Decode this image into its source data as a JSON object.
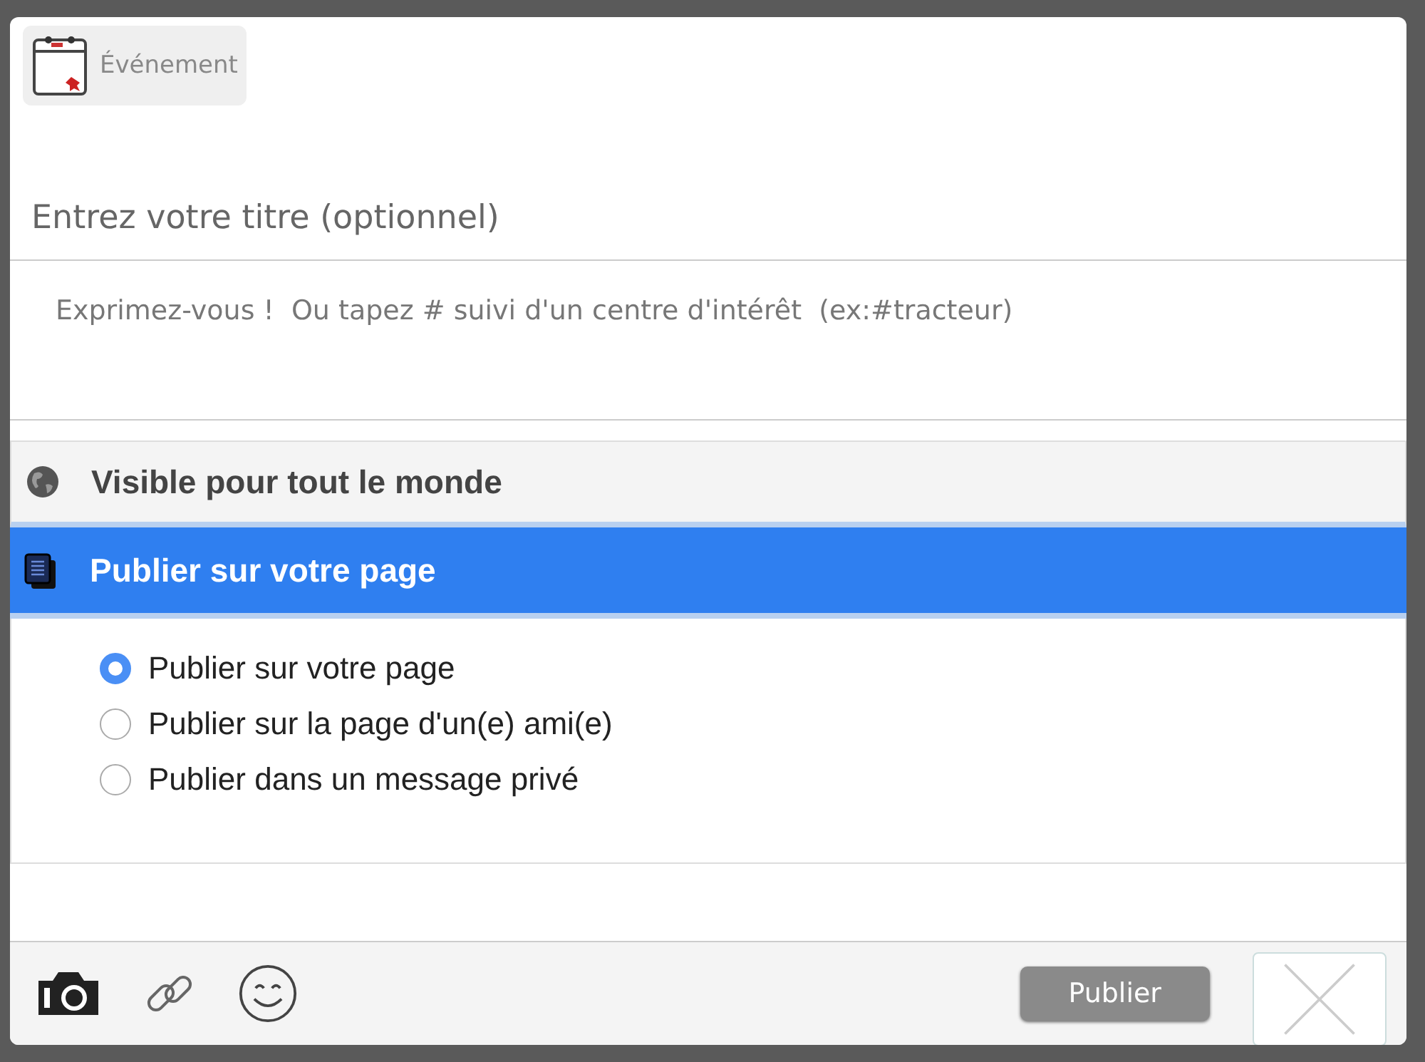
{
  "post_type": {
    "label": "Événement",
    "selected": true
  },
  "title_field": {
    "placeholder": "Entrez votre titre (optionnel)"
  },
  "message_field": {
    "placeholder": "Exprimez-vous !  Ou tapez # suivi d'un centre d'intérêt  (ex:#tracteur)"
  },
  "visibility": {
    "label": "Visible pour tout le monde"
  },
  "destination": {
    "label": "Publier sur votre page",
    "expanded": true
  },
  "options": [
    {
      "label": "Publier sur votre page",
      "selected": true
    },
    {
      "label": "Publier sur la page d'un(e) ami(e)",
      "selected": false
    },
    {
      "label": "Publier dans un message privé",
      "selected": false
    }
  ],
  "footer": {
    "publish_button": "Publier"
  }
}
